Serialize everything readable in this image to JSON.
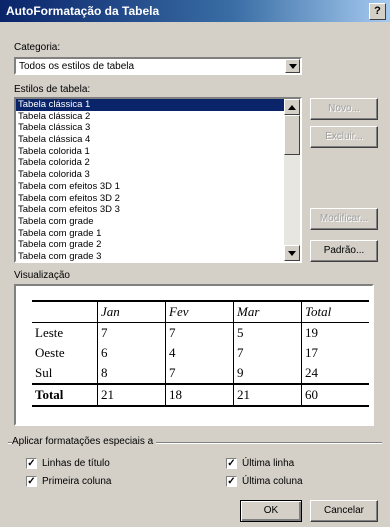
{
  "window": {
    "title": "AutoFormatação da Tabela",
    "help_glyph": "?"
  },
  "category": {
    "label": "Categoria:",
    "value": "Todos os estilos de tabela"
  },
  "styles": {
    "label": "Estilos de tabela:",
    "items": [
      "Tabela clássica 1",
      "Tabela clássica 2",
      "Tabela clássica 3",
      "Tabela clássica 4",
      "Tabela colorida 1",
      "Tabela colorida 2",
      "Tabela colorida 3",
      "Tabela com efeitos 3D 1",
      "Tabela com efeitos 3D 2",
      "Tabela com efeitos 3D 3",
      "Tabela com grade",
      "Tabela com grade 1",
      "Tabela com grade 2",
      "Tabela com grade 3"
    ],
    "selected_index": 0
  },
  "side_buttons": {
    "new": "Novo...",
    "delete": "Excluir...",
    "modify": "Modificar...",
    "default": "Padrão..."
  },
  "preview": {
    "label": "Visualização",
    "header": [
      "",
      "Jan",
      "Fev",
      "Mar",
      "Total"
    ],
    "rows": [
      [
        "Leste",
        "7",
        "7",
        "5",
        "19"
      ],
      [
        "Oeste",
        "6",
        "4",
        "7",
        "17"
      ],
      [
        "Sul",
        "8",
        "7",
        "9",
        "24"
      ]
    ],
    "total": [
      "Total",
      "21",
      "18",
      "21",
      "60"
    ]
  },
  "special": {
    "label": "Aplicar formatações especiais a",
    "options": [
      {
        "label": "Linhas de título",
        "checked": true
      },
      {
        "label": "Primeira coluna",
        "checked": true
      },
      {
        "label": "Última linha",
        "checked": true
      },
      {
        "label": "Última coluna",
        "checked": true
      }
    ]
  },
  "footer": {
    "ok": "OK",
    "cancel": "Cancelar"
  },
  "check_glyph": "✓"
}
